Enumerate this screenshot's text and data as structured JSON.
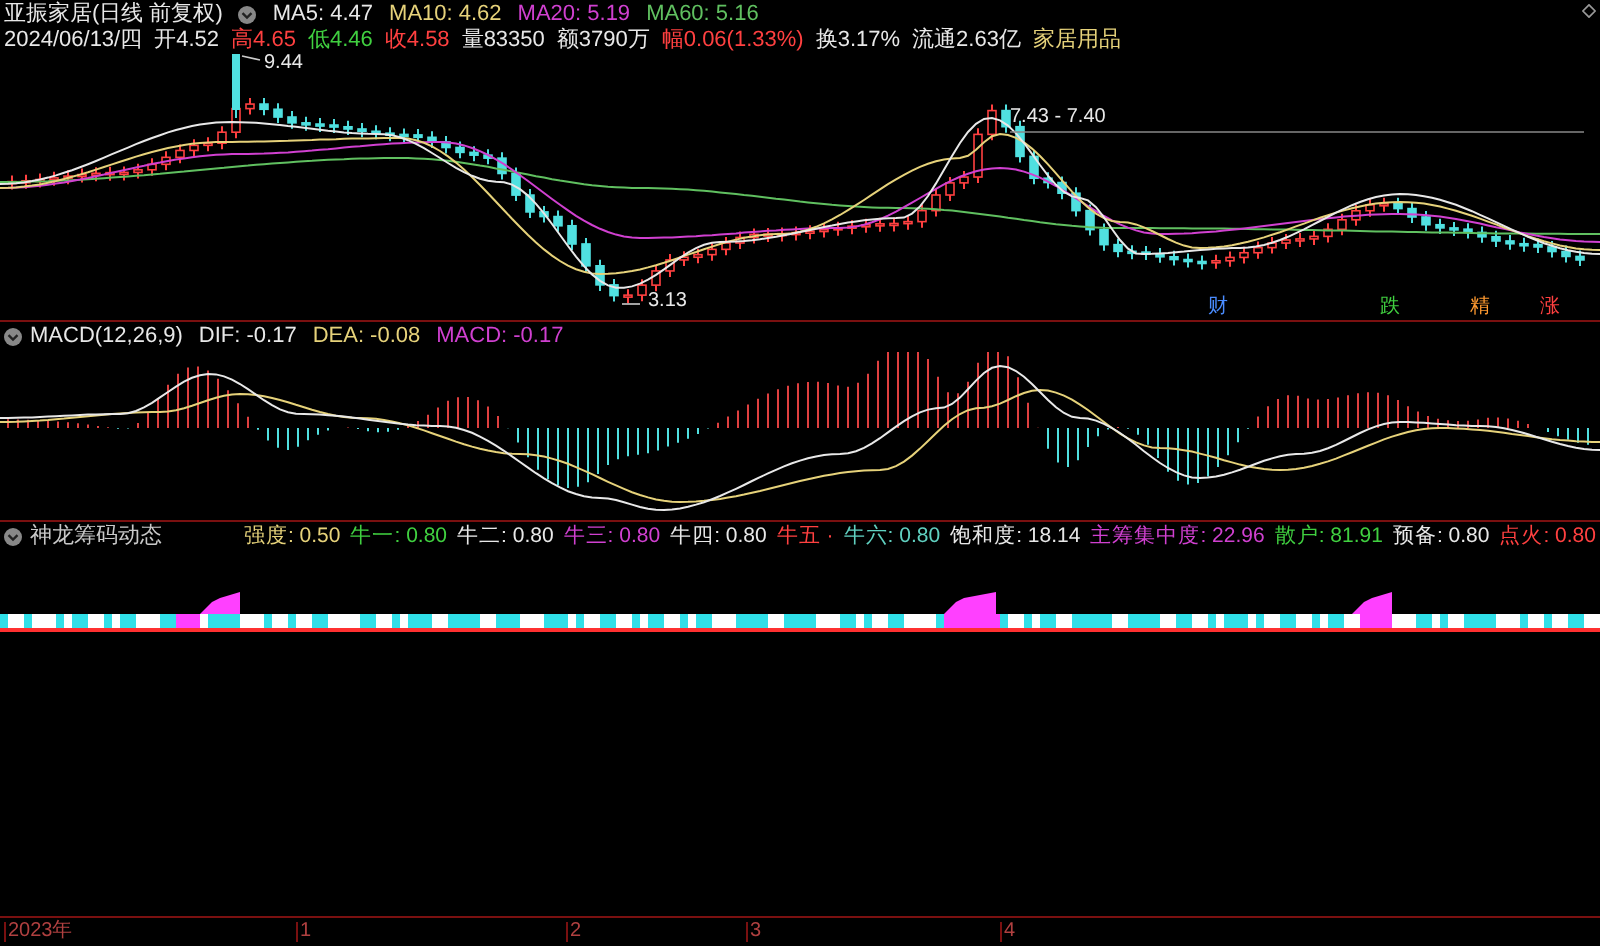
{
  "chart_header": {
    "title": "亚振家居(日线 前复权)",
    "averages": [
      {
        "text": "MA5: 4.47",
        "color": "#e8e8e8"
      },
      {
        "text": "MA10: 4.62",
        "color": "#e6d27a"
      },
      {
        "text": "MA20: 5.19",
        "color": "#d040d0"
      },
      {
        "text": "MA60: 5.16",
        "color": "#60c060"
      }
    ]
  },
  "quote": [
    {
      "text": "2024/06/13/四",
      "color": "#e8e8e8"
    },
    {
      "text": "开4.52",
      "color": "#e8e8e8"
    },
    {
      "text": "高4.65",
      "color": "#ff4040"
    },
    {
      "text": "低4.46",
      "color": "#40d040"
    },
    {
      "text": "收4.58",
      "color": "#ff4040"
    },
    {
      "text": "量83350",
      "color": "#e8e8e8"
    },
    {
      "text": "额3790万",
      "color": "#e8e8e8"
    },
    {
      "text": "幅0.06(1.33%)",
      "color": "#ff4040"
    },
    {
      "text": "换3.17%",
      "color": "#e8e8e8"
    },
    {
      "text": "流通2.63亿",
      "color": "#e8e8e8"
    },
    {
      "text": "家居用品",
      "color": "#e6d27a"
    }
  ],
  "price_annotations": [
    {
      "kind": "high",
      "text": "9.44"
    },
    {
      "kind": "range",
      "text": "7.43 - 7.40"
    },
    {
      "kind": "low",
      "text": "3.13"
    }
  ],
  "signal_markers": [
    {
      "text": "财",
      "color": "#4a8cff"
    },
    {
      "text": "跌",
      "color": "#40d040"
    },
    {
      "text": "精",
      "color": "#ff9a30"
    },
    {
      "text": "涨",
      "color": "#ff4040"
    }
  ],
  "macd_header": {
    "title": "MACD(12,26,9)",
    "values": [
      {
        "text": "DIF: -0.17",
        "color": "#e8e8e8"
      },
      {
        "text": "DEA: -0.08",
        "color": "#e6d27a"
      },
      {
        "text": "MACD: -0.17",
        "color": "#d040d0"
      }
    ]
  },
  "indicator_header": {
    "title": "神龙筹码动态",
    "values": [
      {
        "text": "强度: 0.50",
        "color": "#e6d27a"
      },
      {
        "text": "牛一: 0.80",
        "color": "#40d040"
      },
      {
        "text": "牛二: 0.80",
        "color": "#e8e8e8"
      },
      {
        "text": "牛三: 0.80",
        "color": "#d040d0"
      },
      {
        "text": "牛四: 0.80",
        "color": "#e8e8e8"
      },
      {
        "text": "牛五 ·",
        "color": "#ff4040"
      },
      {
        "text": "牛六: 0.80",
        "color": "#60d0c0"
      },
      {
        "text": "饱和度: 18.14",
        "color": "#e8e8e8"
      },
      {
        "text": "主筹集中度: 22.96",
        "color": "#d040d0"
      },
      {
        "text": "散户: 81.91",
        "color": "#40d040"
      },
      {
        "text": "预备: 0.80",
        "color": "#e8e8e8"
      },
      {
        "text": "点火: 0.80",
        "color": "#ff4040"
      }
    ]
  },
  "time_axis": [
    "2023年",
    "1",
    "2",
    "3",
    "4"
  ]
}
